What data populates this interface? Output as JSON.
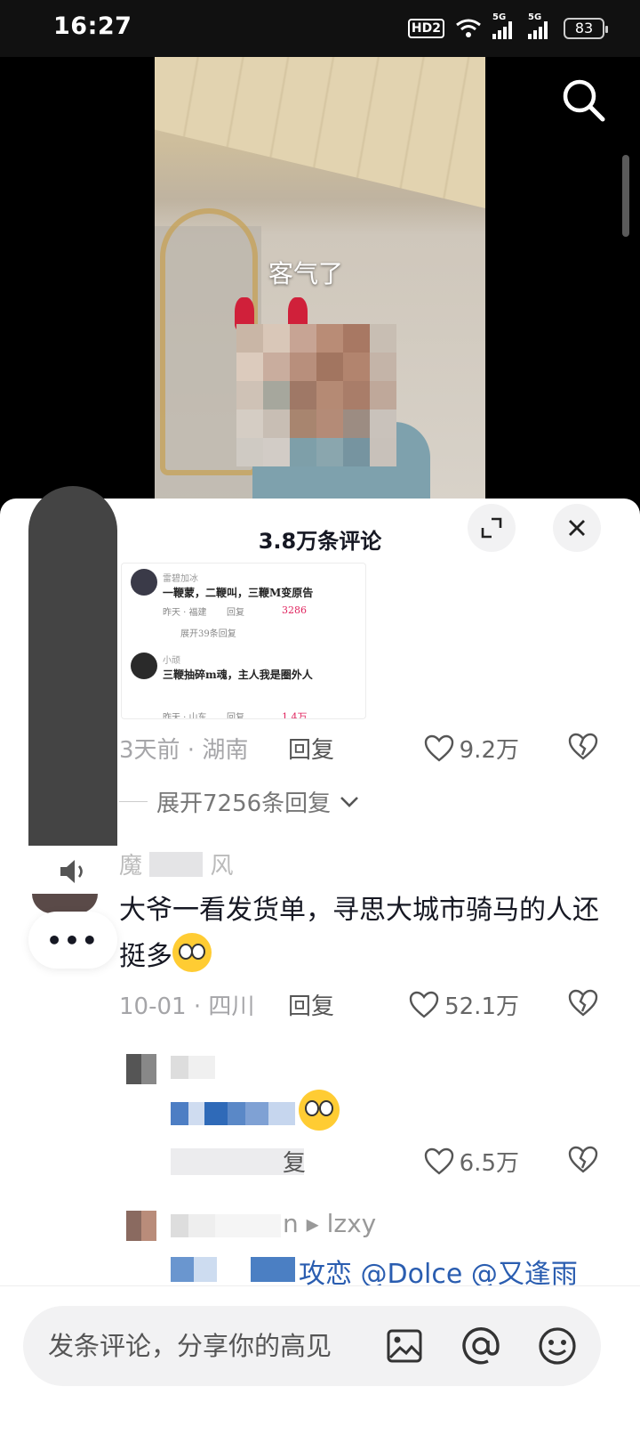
{
  "status_bar": {
    "time": "16:27",
    "hd": "HD2",
    "net1": "5G",
    "net2": "5G",
    "battery": "83"
  },
  "video": {
    "caption": "客气了"
  },
  "comments": {
    "title": "3.8万条评论",
    "screenshot": {
      "c1_name": "雷碧加冰",
      "c1_text": "一鞭蒙，二鞭叫，三鞭M变原告",
      "c1_meta": "昨天 · 福建",
      "c1_reply": "回复",
      "c1_likes": "3286",
      "c1_expand": "展开39条回复",
      "c2_name": "小顽",
      "c2_text": "三鞭抽碎m魂，主人我是圈外人",
      "c2_meta": "昨天 · 山东",
      "c2_reply": "回复",
      "c2_likes": "1.4万"
    },
    "item1": {
      "when": "3天前 · 湖南",
      "reply": "回复",
      "likes": "9.2万",
      "expand": "展开7256条回复"
    },
    "item2": {
      "name": "魔",
      "name_tail": "风",
      "text": "大爷一看发货单，寻思大城市骑马的人还挺多",
      "when": "10-01 · 四川",
      "reply": "回复",
      "likes": "52.1万"
    },
    "reply1": {
      "reply": "复",
      "likes": "6.5万"
    },
    "reply2": {
      "name_tail": "n ▸ lzxy",
      "text": "攻恋 @Dolce @又逢雨"
    }
  },
  "input": {
    "placeholder": "发条评论，分享你的高见"
  }
}
